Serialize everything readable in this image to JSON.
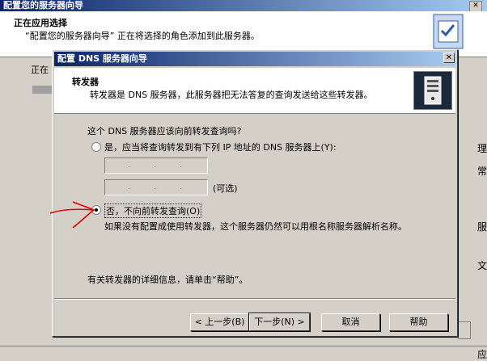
{
  "background_window": {
    "title": "配置您的服务器向导",
    "header_title": "正在应用选择",
    "header_subtitle": "“配置您的服务器向导” 正在将选择的角色添加到此服务器。",
    "status_text": "正在",
    "right_edge_texts": [
      "理",
      "常",
      "服",
      "文",
      "应"
    ]
  },
  "dialog": {
    "title": "配置 DNS 服务器向导",
    "close_glyph": "✕",
    "header_title": "转发器",
    "header_subtitle": "转发器是 DNS 服务器，此服务器把无法答复的查询发送给这些转发器。",
    "question": "这个 DNS 服务器应该向前转发查询吗?",
    "option_yes": "是，应当将查询转发到有下列 IP 地址的 DNS 服务器上(Y):",
    "ip_placeholder": ".   .   .",
    "optional_label": "(可选)",
    "option_no": "否，不向前转发查询(O)",
    "selected_option": "no",
    "no_description": "如果没有配置成使用转发器，这个服务器仍然可以用根名称服务器解析名称。",
    "help_hint": "有关转发器的详细信息，请单击“帮助”。",
    "buttons": {
      "back": "< 上一步(B)",
      "next": "下一步(N) >",
      "cancel": "取消",
      "help": "帮助"
    }
  },
  "colors": {
    "titlebar_start": "#0a246a",
    "titlebar_end": "#a6caf0",
    "window_face": "#d4d0c8",
    "annotation_arrow": "#e00000"
  }
}
